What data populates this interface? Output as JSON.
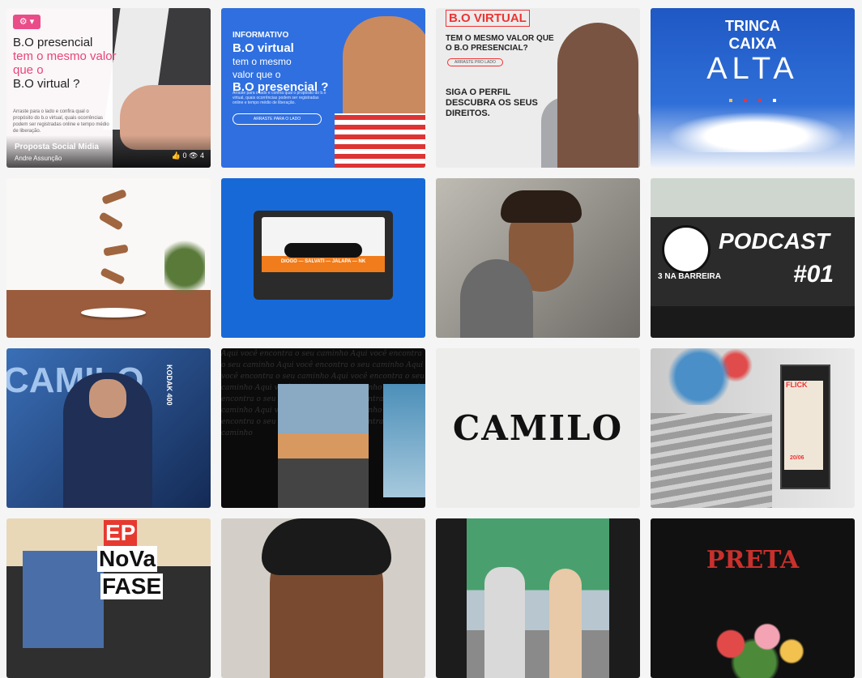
{
  "grid": {
    "items": [
      {
        "id": "b-o-presencial",
        "settings_label": "⚙ ▾",
        "line1": "B.O presencial",
        "line2": "tem o mesmo valor",
        "line3": "que o",
        "line4": "B.O virtual ?",
        "body": "Arraste para o lado e confira qual o propósito do b.o virtual, quais ocorrências podem ser registradas online e tempo médio de liberação.",
        "title": "Proposta Social Midia",
        "author": "Andre Assunção",
        "likes": "0",
        "views": "4"
      },
      {
        "id": "informativo",
        "label": "INFORMATIVO",
        "line1": "B.O virtual",
        "line2": "tem o mesmo",
        "line3": "valor que o",
        "line4": "B.O presencial ?",
        "body": "Arraste para o lado e confira qual o propósito do b.o virtual, quais ocorrências podem ser registradas online e tempo médio de liberação.",
        "button": "ARRASTE PARA O LADO"
      },
      {
        "id": "bo-virtual",
        "tag": "B.O VIRTUAL",
        "question": "TEM O MESMO VALOR QUE O B.O PRESENCIAL?",
        "arrow": "ARRASTE PRO LADO",
        "follow": "SIGA O PERFIL DESCUBRA OS SEUS DIREITOS."
      },
      {
        "id": "trinca-caixa-alta",
        "line1": "TRINCA",
        "line2": "CAIXA",
        "line3": "ALTA"
      },
      {
        "id": "bakery-photo"
      },
      {
        "id": "cassette",
        "strip": "DIOGO — SALVATI — JALAPA — NK"
      },
      {
        "id": "portrait-boy"
      },
      {
        "id": "podcast",
        "brand": "3 NA BARREIRA",
        "title": "PODCAST",
        "number": "#01"
      },
      {
        "id": "camilo-photo",
        "bg_text": "CAMILO",
        "side_text": "KODAK 400"
      },
      {
        "id": "script-collage"
      },
      {
        "id": "camilo-logo",
        "logo": "CAMILO"
      },
      {
        "id": "street-poster",
        "poster_title": "FLICK",
        "date": "20/06"
      },
      {
        "id": "ep-nova-fase",
        "line1": "EP",
        "line2": "NoVa",
        "line3": "FASE"
      },
      {
        "id": "curly-portrait"
      },
      {
        "id": "sempre-firme"
      },
      {
        "id": "preta",
        "title": "PRETA"
      }
    ]
  },
  "colors": {
    "pink": "#ea4c89",
    "blue": "#2f6fe0",
    "red": "#e33333",
    "dark": "#111111"
  }
}
